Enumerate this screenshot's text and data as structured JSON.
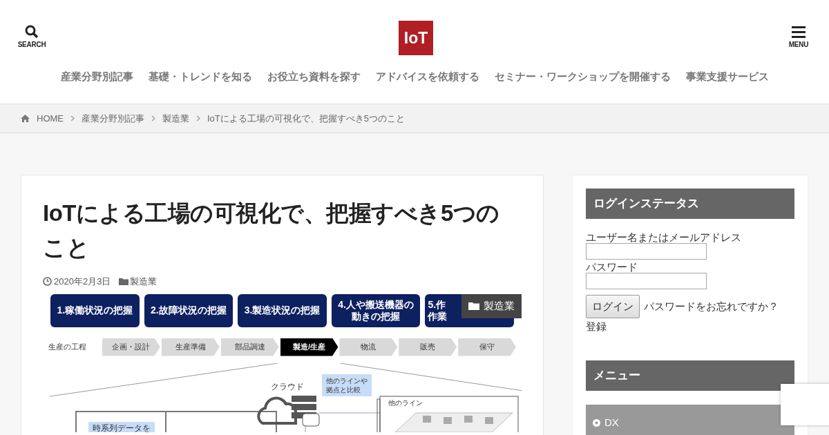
{
  "header": {
    "search_label": "SEARCH",
    "logo": "IoT",
    "menu_label": "MENU"
  },
  "nav": [
    "産業分野別記事",
    "基礎・トレンドを知る",
    "お役立ち資料を探す",
    "アドバイスを依頼する",
    "セミナー・ワークショップを開催する",
    "事業支援サービス"
  ],
  "breadcrumb": [
    "HOME",
    "産業分野別記事",
    "製造業",
    "IoTによる工場の可視化で、把握すべき5つのこと"
  ],
  "article": {
    "title": "IoTによる工場の可視化で、把握すべき5つのこと",
    "date": "2020年2月3日",
    "category": "製造業",
    "image_badge": "製造業",
    "figure": {
      "points": [
        [
          "1.稼働状況の把握"
        ],
        [
          "2.故障状況の把握"
        ],
        [
          "3.製造状況の把握"
        ],
        [
          "4.人や搬送機器の",
          "動きの把握"
        ],
        [
          "5.作",
          "作業"
        ]
      ],
      "process_label": "生産の工程",
      "steps": [
        {
          "label": "企画・設計",
          "selected": false
        },
        {
          "label": "生産準備",
          "selected": false
        },
        {
          "label": "部品調達",
          "selected": false
        },
        {
          "label": "製造/生産",
          "selected": true
        },
        {
          "label": "物流",
          "selected": false
        },
        {
          "label": "販売",
          "selected": false
        },
        {
          "label": "保守",
          "selected": false
        }
      ],
      "cloud_label": "クラウド",
      "compare_note": [
        "他のラインや",
        "拠点と比較"
      ],
      "other_line": "他のライン",
      "timeseries_note": "時系列データを"
    }
  },
  "sidebar": {
    "login": {
      "title": "ログインステータス",
      "user_label": "ユーザー名またはメールアドレス",
      "password_label": "パスワード",
      "button": "ログイン",
      "forgot": "パスワードをお忘れですか？",
      "register": "登録"
    },
    "menu": {
      "title": "メニュー",
      "items": [
        "DX"
      ]
    }
  }
}
